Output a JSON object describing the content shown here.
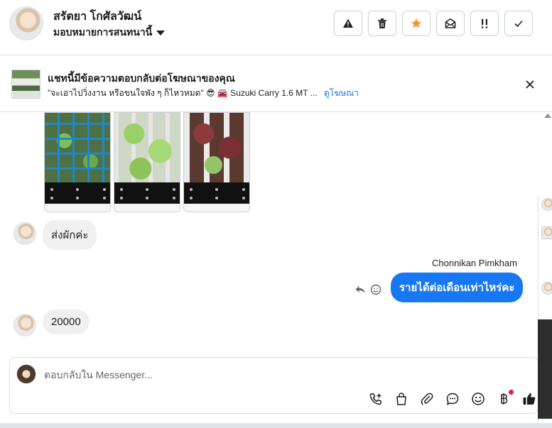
{
  "header": {
    "contact_name": "สรัตยา โกศัลวัฒน์",
    "assign_label": "มอบหมายการสนทนานี้"
  },
  "header_buttons": [
    {
      "name": "warning-button",
      "icon": "warning-icon"
    },
    {
      "name": "delete-button",
      "icon": "trash-icon"
    },
    {
      "name": "star-button",
      "icon": "star-icon",
      "color": "#f7923b"
    },
    {
      "name": "mark-unread-button",
      "icon": "envelope-open-icon"
    },
    {
      "name": "priority-button",
      "icon": "exclamation-icon"
    },
    {
      "name": "done-button",
      "icon": "check-icon"
    }
  ],
  "ad": {
    "title": "แชทนี้มีข้อความตอบกลับต่อโฆษณาของคุณ",
    "subtitle": "\"จะเอาไปวิ่งงาน หรือขนใจพัง ๆ ก็ไหวหมด\" 😎 🚘 Suzuki Carry 1.6 MT ...",
    "link_label": "ดูโฆษณา"
  },
  "messages": {
    "incoming_1": "ส่งผักค่ะ",
    "sender_name": "Chonnikan Pimkham",
    "outgoing_1": "รายได้ต่อเดือนเท่าไหร่คะ",
    "incoming_2": "20000"
  },
  "composer": {
    "placeholder": "ตอบกลับใน Messenger..."
  },
  "composer_tools": [
    "phone-add-icon",
    "shopping-bag-icon",
    "paperclip-icon",
    "chat-bubble-icon",
    "emoji-icon",
    "baht-icon",
    "thumbs-up-icon"
  ],
  "colors": {
    "accent": "#1877f2",
    "star": "#f7923b",
    "notification": "#e41e3f"
  }
}
